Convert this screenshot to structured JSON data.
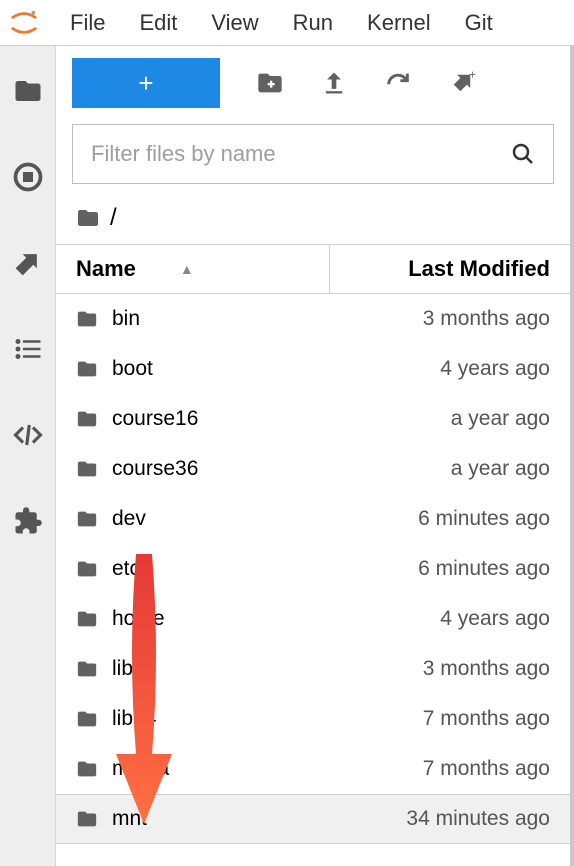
{
  "menu": [
    "File",
    "Edit",
    "View",
    "Run",
    "Kernel",
    "Git"
  ],
  "leftRail": {
    "icons": [
      "folder-icon",
      "stop-running-icon",
      "git-branch-icon",
      "list-icon",
      "code-icon",
      "puzzle-icon"
    ]
  },
  "toolbar": {
    "newLabel": "+",
    "icons": [
      "new-folder-icon",
      "upload-icon",
      "refresh-icon",
      "git-clone-icon"
    ]
  },
  "filter": {
    "placeholder": "Filter files by name"
  },
  "breadcrumb": {
    "path": "/"
  },
  "columns": {
    "name": "Name",
    "modified": "Last Modified"
  },
  "files": [
    {
      "name": "bin",
      "modified": "3 months ago"
    },
    {
      "name": "boot",
      "modified": "4 years ago"
    },
    {
      "name": "course16",
      "modified": "a year ago"
    },
    {
      "name": "course36",
      "modified": "a year ago"
    },
    {
      "name": "dev",
      "modified": "6 minutes ago"
    },
    {
      "name": "etc",
      "modified": "6 minutes ago"
    },
    {
      "name": "home",
      "modified": "4 years ago"
    },
    {
      "name": "lib",
      "modified": "3 months ago"
    },
    {
      "name": "lib64",
      "modified": "7 months ago"
    },
    {
      "name": "media",
      "modified": "7 months ago"
    },
    {
      "name": "mnt",
      "modified": "34 minutes ago"
    }
  ],
  "highlightIndex": 10
}
